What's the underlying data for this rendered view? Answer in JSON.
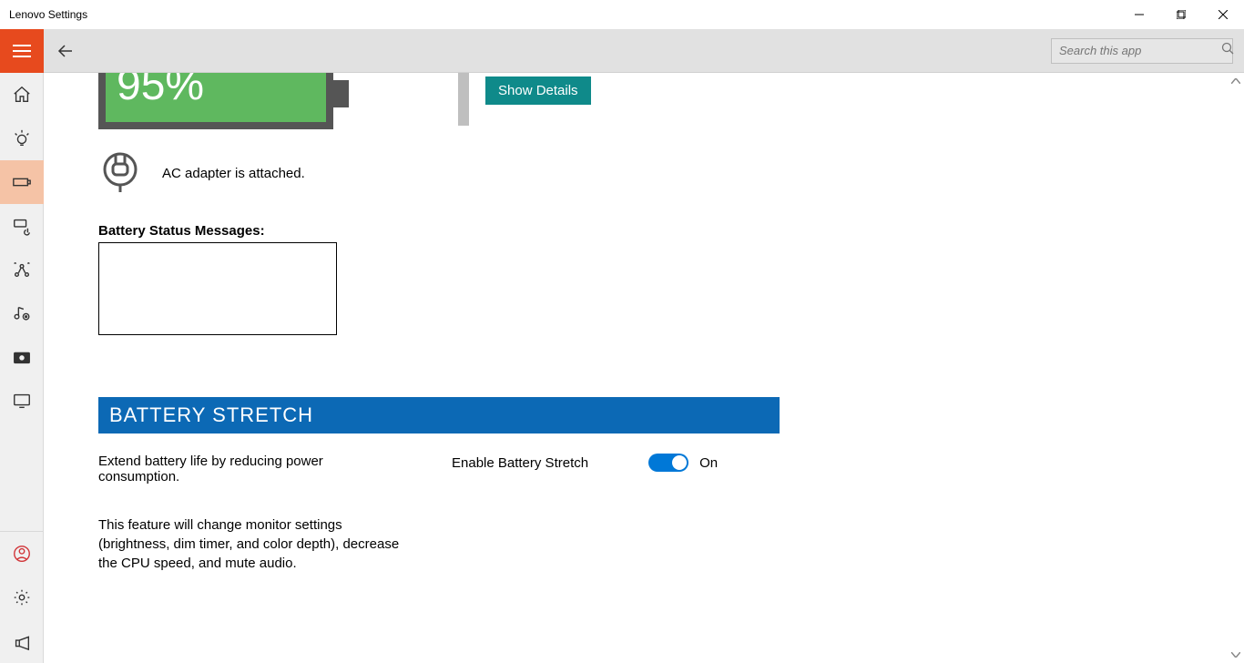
{
  "window": {
    "title": "Lenovo Settings"
  },
  "toolbar": {
    "search_placeholder": "Search this app"
  },
  "battery": {
    "percent": "95%",
    "show_details": "Show Details",
    "ac_text": "AC adapter is attached.",
    "status_label": "Battery Status Messages:"
  },
  "stretch": {
    "header": "BATTERY STRETCH",
    "desc1": "Extend battery life by reducing power consumption.",
    "desc2": "This feature will change monitor settings (brightness, dim timer, and color depth), decrease the CPU speed, and mute audio.",
    "enable_label": "Enable Battery Stretch",
    "state": "On"
  }
}
